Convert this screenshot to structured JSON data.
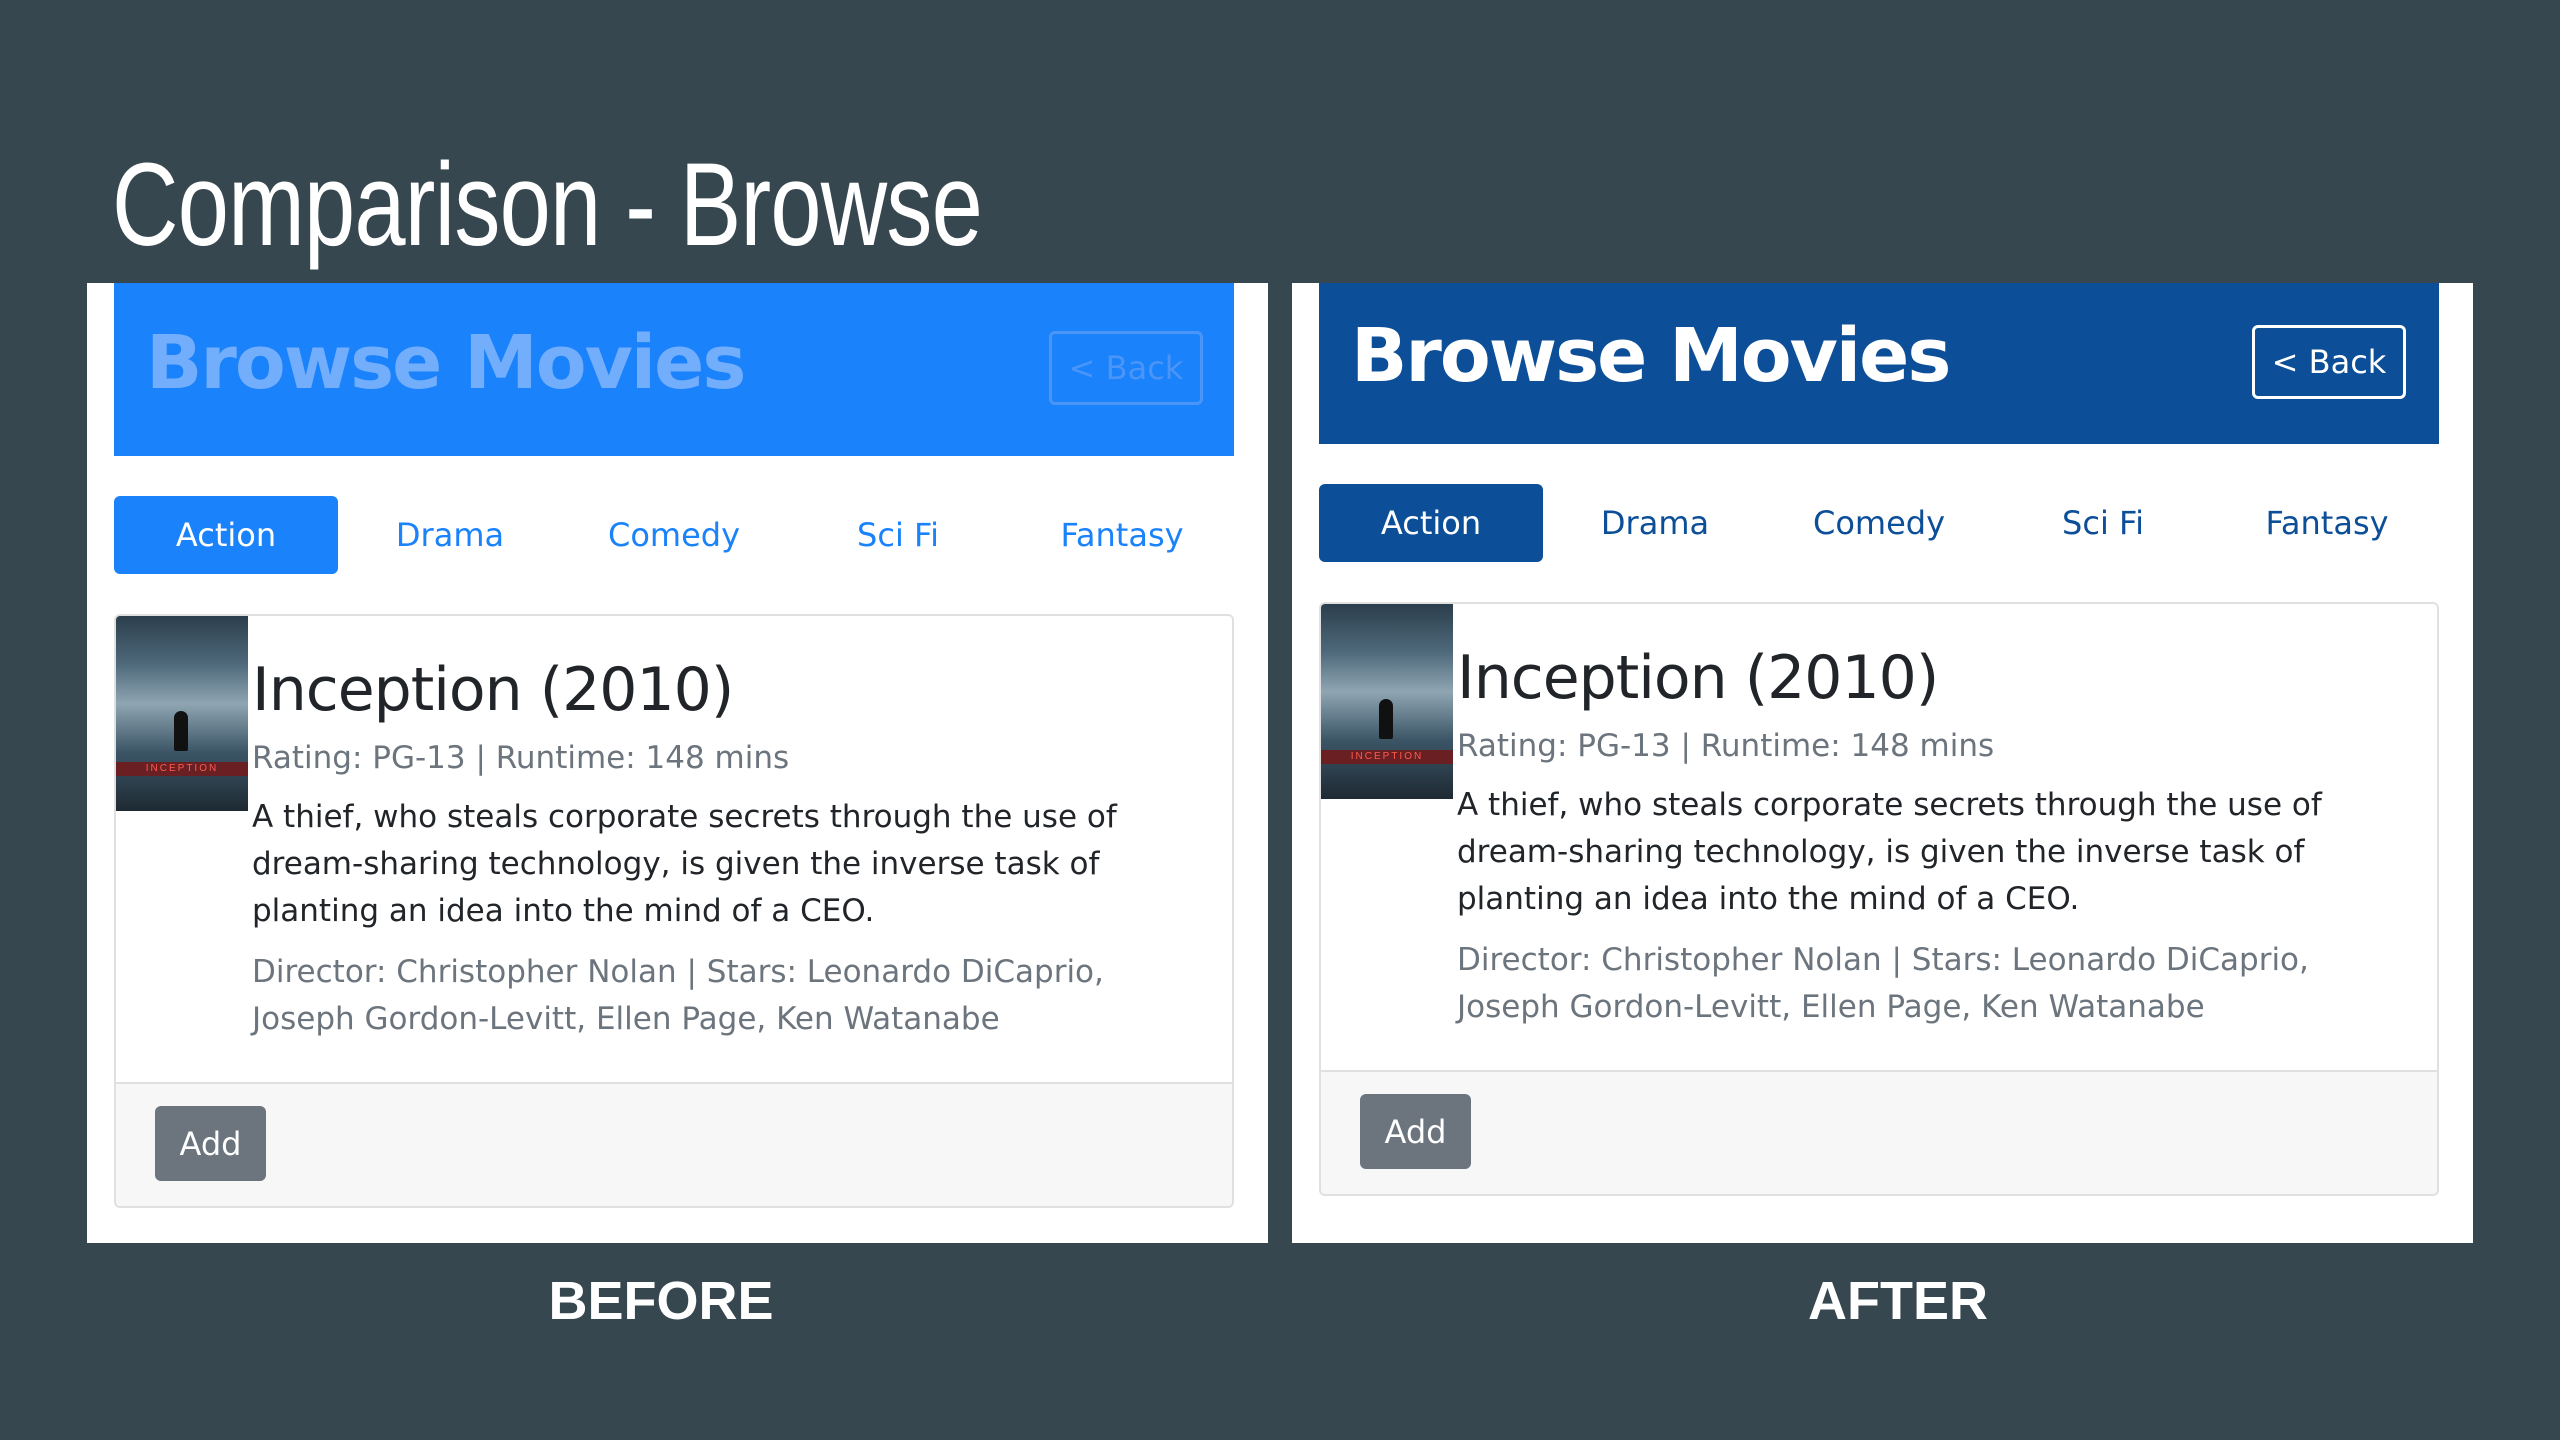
{
  "slide": {
    "title": "Comparison - Browse"
  },
  "panels": [
    {
      "caption": "BEFORE",
      "header": {
        "title": "Browse Movies",
        "back_label": "< Back"
      },
      "colors": {
        "header_bg": "#1a82fb",
        "title_text": "#73aefc",
        "accent": "#1a82fb"
      },
      "tabs": [
        {
          "label": "Action",
          "active": true
        },
        {
          "label": "Drama",
          "active": false
        },
        {
          "label": "Comedy",
          "active": false
        },
        {
          "label": "Sci Fi",
          "active": false
        },
        {
          "label": "Fantasy",
          "active": false
        }
      ],
      "movie": {
        "poster_text": "INCEPTION",
        "title": "Inception (2010)",
        "meta": "Rating: PG-13 | Runtime: 148 mins",
        "plot": "A thief, who steals corporate secrets through the use of dream-sharing technology, is given the inverse task of planting an idea into the mind of a CEO.",
        "credits": "Director: Christopher Nolan | Stars: Leonardo DiCaprio, Joseph Gordon-Levitt, Ellen Page, Ken Watanabe",
        "add_label": "Add"
      }
    },
    {
      "caption": "AFTER",
      "header": {
        "title": "Browse Movies",
        "back_label": "< Back"
      },
      "colors": {
        "header_bg": "#0c4f98",
        "title_text": "#ffffff",
        "accent": "#0c4f98"
      },
      "tabs": [
        {
          "label": "Action",
          "active": true
        },
        {
          "label": "Drama",
          "active": false
        },
        {
          "label": "Comedy",
          "active": false
        },
        {
          "label": "Sci Fi",
          "active": false
        },
        {
          "label": "Fantasy",
          "active": false
        }
      ],
      "movie": {
        "poster_text": "INCEPTION",
        "title": "Inception (2010)",
        "meta": "Rating: PG-13 | Runtime: 148 mins",
        "plot": "A thief, who steals corporate secrets through the use of dream-sharing technology, is given the inverse task of planting an idea into the mind of a CEO.",
        "credits": "Director: Christopher Nolan | Stars: Leonardo DiCaprio, Joseph Gordon-Levitt, Ellen Page, Ken Watanabe",
        "add_label": "Add"
      }
    }
  ],
  "icons": {
    "poster": "movie-poster-image"
  },
  "colors": {
    "background": "#37474f",
    "add_button": "#6c757d"
  }
}
